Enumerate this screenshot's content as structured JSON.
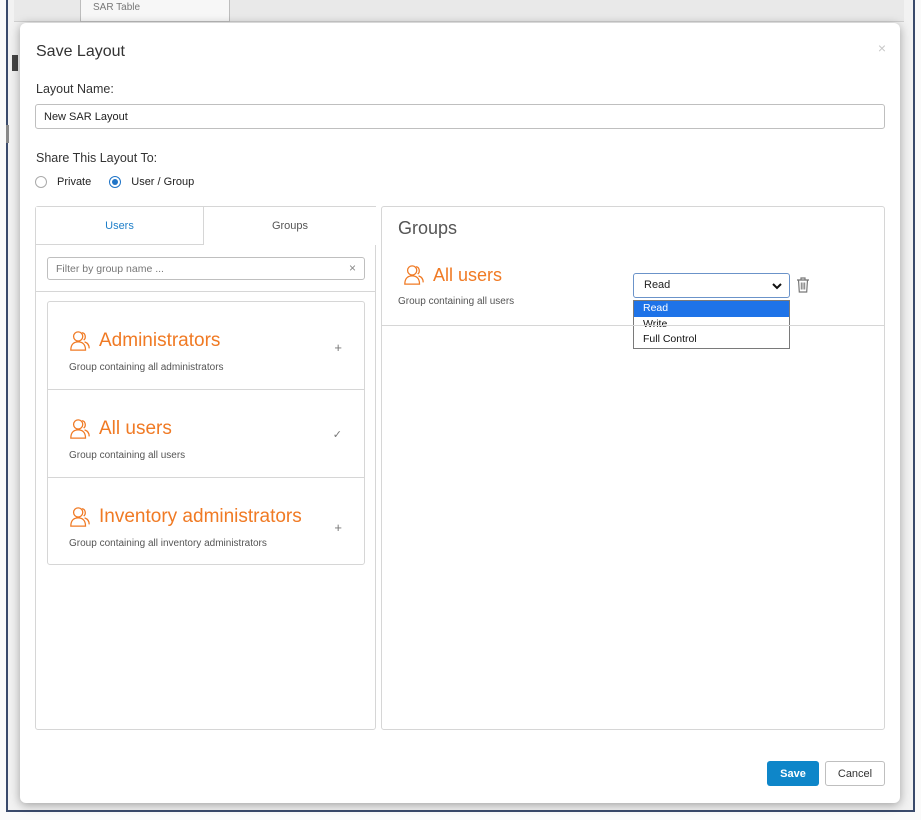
{
  "background": {
    "tab_label": "SAR Table"
  },
  "dialog": {
    "title": "Save Layout",
    "close_glyph": "×",
    "layout_name_label": "Layout Name:",
    "layout_name_value": "New SAR Layout",
    "share_label": "Share This Layout To:",
    "share_options": [
      {
        "label": "Private",
        "checked": false
      },
      {
        "label": "User / Group",
        "checked": true
      }
    ]
  },
  "left_panel": {
    "tabs": [
      {
        "label": "Users",
        "active": false
      },
      {
        "label": "Groups",
        "active": true
      }
    ],
    "filter_placeholder": "Filter by group name ...",
    "filter_clear_glyph": "×",
    "groups": [
      {
        "name": "Administrators",
        "description": "Group containing all administrators",
        "action": "+",
        "icon": "group-person-icon"
      },
      {
        "name": "All users",
        "description": "Group containing all users",
        "action": "✓",
        "icon": "group-person-icon"
      },
      {
        "name": "Inventory administrators",
        "description": "Group containing all inventory administrators",
        "action": "+",
        "icon": "group-person-icon"
      }
    ]
  },
  "right_panel": {
    "title": "Groups",
    "selected_group": {
      "name": "All users",
      "description": "Group containing all users",
      "permission": "Read",
      "permission_options": [
        "Read",
        "Write",
        "Full Control"
      ],
      "highlighted_option": "Read"
    }
  },
  "footer": {
    "save_label": "Save",
    "cancel_label": "Cancel"
  },
  "colors": {
    "accent_orange": "#f07a24",
    "primary_blue": "#0e86c9",
    "tab_blue": "#1f7fc9",
    "dropdown_highlight": "#1e73e8"
  }
}
